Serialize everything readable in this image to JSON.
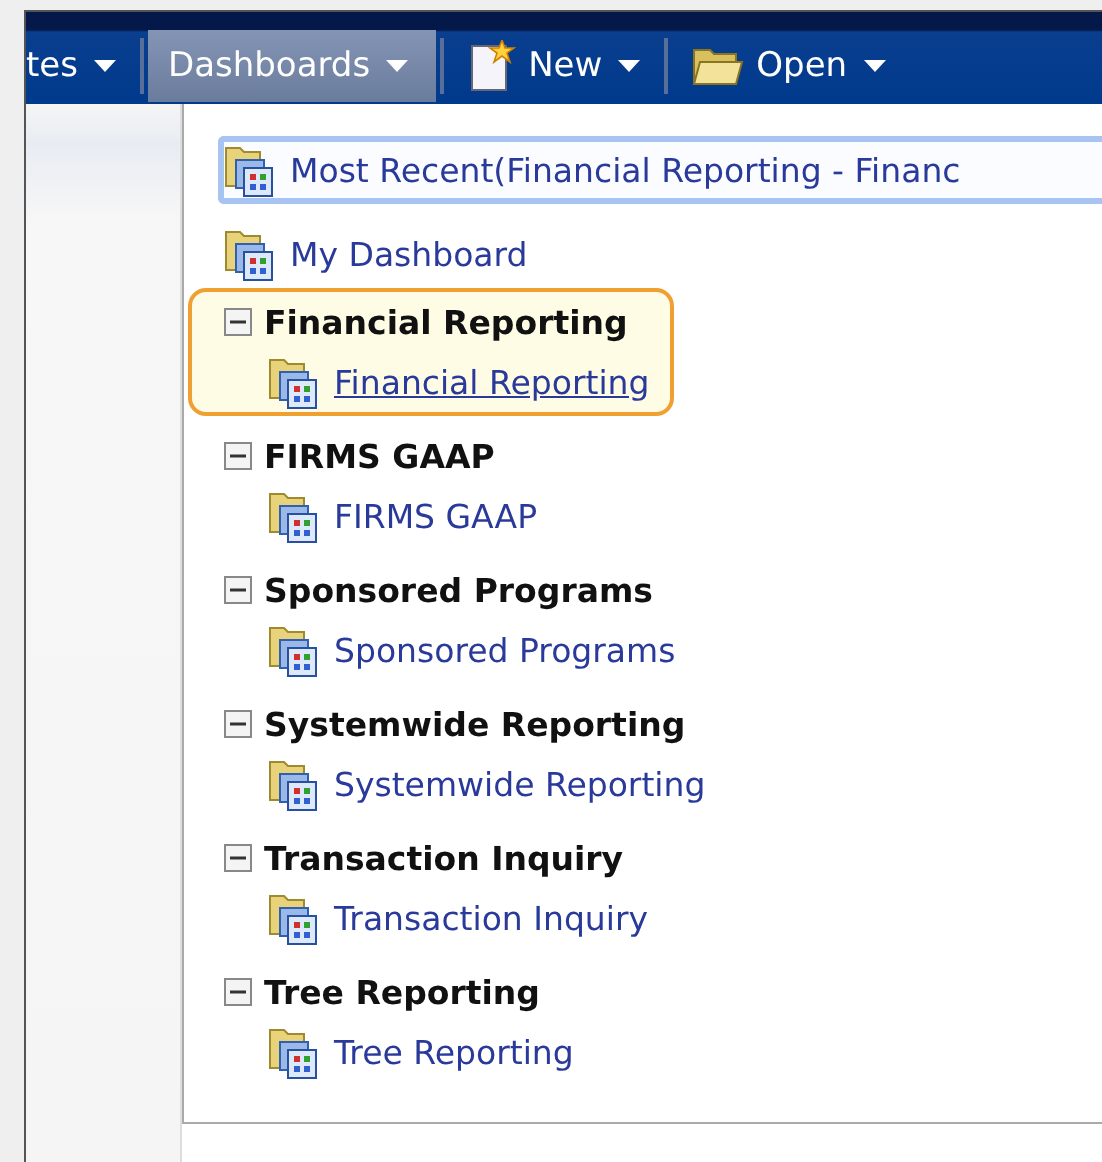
{
  "navbar": {
    "items": [
      {
        "label": "tes",
        "kind": "menu",
        "selected": false
      },
      {
        "label": "Dashboards",
        "kind": "menu",
        "selected": true
      },
      {
        "label": "New",
        "kind": "new",
        "selected": false
      },
      {
        "label": "Open",
        "kind": "open",
        "selected": false
      }
    ]
  },
  "menu": {
    "recent": {
      "label": "Most Recent(Financial Reporting - Financ",
      "selected": true
    },
    "items": [
      {
        "label": "My Dashboard"
      }
    ],
    "groups": [
      {
        "label": "Financial Reporting",
        "expanded": true,
        "selected": true,
        "children": [
          {
            "label": "Financial Reporting"
          }
        ]
      },
      {
        "label": "FIRMS GAAP",
        "expanded": true,
        "selected": false,
        "children": [
          {
            "label": "FIRMS GAAP"
          }
        ]
      },
      {
        "label": "Sponsored Programs",
        "expanded": true,
        "selected": false,
        "children": [
          {
            "label": "Sponsored Programs"
          }
        ]
      },
      {
        "label": "Systemwide Reporting",
        "expanded": true,
        "selected": false,
        "children": [
          {
            "label": "Systemwide Reporting"
          }
        ]
      },
      {
        "label": "Transaction Inquiry",
        "expanded": true,
        "selected": false,
        "children": [
          {
            "label": "Transaction Inquiry"
          }
        ]
      },
      {
        "label": "Tree Reporting",
        "expanded": true,
        "selected": false,
        "children": [
          {
            "label": "Tree Reporting"
          }
        ]
      }
    ]
  }
}
